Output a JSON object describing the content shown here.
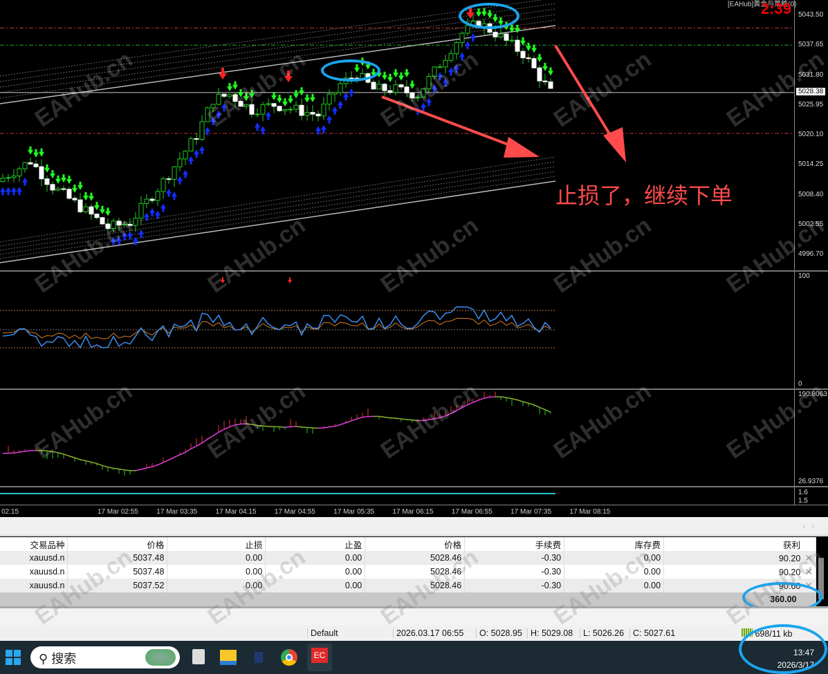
{
  "chart": {
    "title": "[EAHub]黄金与策略(0)",
    "countdown": "2:39",
    "current_price": "5028.38",
    "price_labels": [
      "5043.50",
      "5037.65",
      "5031.80",
      "5025.95",
      "5020.10",
      "5014.25",
      "5008.40",
      "5002.55",
      "4996.70"
    ],
    "rsi_labels": [
      "100",
      "0"
    ],
    "osc_labels": [
      "190.8063",
      "26.9376"
    ],
    "vol_labels": [
      "1.6",
      "1.5"
    ],
    "time_labels": [
      "02:15",
      "17 Mar 02:55",
      "17 Mar 03:35",
      "17 Mar 04:15",
      "17 Mar 04:55",
      "17 Mar 05:35",
      "17 Mar 06:15",
      "17 Mar 06:55",
      "17 Mar 07:35",
      "17 Mar 08:15"
    ],
    "annotation": "止损了，继续下单",
    "watermark": "EAHub.cn",
    "colors": {
      "bull_arrow": "#1030ff",
      "bear_arrow": "#20ff20",
      "signal": "#ff2020",
      "highlight": "#1ba4ee",
      "annotation": "#ff4b4b"
    }
  },
  "chart_data": {
    "type": "candlestick",
    "price_path": [
      [
        0,
        5011
      ],
      [
        6,
        5015
      ],
      [
        10,
        5010
      ],
      [
        15,
        5006
      ],
      [
        20,
        5002
      ],
      [
        24,
        5003
      ],
      [
        30,
        5011
      ],
      [
        36,
        5020
      ],
      [
        39,
        5027
      ],
      [
        42,
        5028
      ],
      [
        46,
        5025
      ],
      [
        50,
        5026
      ],
      [
        54,
        5025
      ],
      [
        58,
        5024
      ],
      [
        62,
        5030
      ],
      [
        65,
        5032
      ],
      [
        68,
        5029
      ],
      [
        72,
        5029
      ],
      [
        76,
        5028
      ],
      [
        80,
        5034
      ],
      [
        84,
        5040
      ],
      [
        87,
        5042
      ],
      [
        90,
        5040
      ],
      [
        95,
        5036
      ],
      [
        100,
        5028.4
      ]
    ],
    "ylim": [
      4994,
      5046
    ]
  },
  "positions": {
    "headers": [
      "交易品种",
      "价格",
      "止损",
      "止盈",
      "价格",
      "手续费",
      "库存费",
      "获利"
    ],
    "rows": [
      [
        "xauusd.n",
        "5037.48",
        "0.00",
        "0.00",
        "5028.46",
        "-0.30",
        "0.00",
        "90.20"
      ],
      [
        "xauusd.n",
        "5037.48",
        "0.00",
        "0.00",
        "5028.46",
        "-0.30",
        "0.00",
        "90.20"
      ],
      [
        "xauusd.n",
        "5037.52",
        "0.00",
        "0.00",
        "5028.46",
        "-0.30",
        "0.00",
        "90.60"
      ]
    ],
    "total": "360.00",
    "close_glyph": "✕"
  },
  "status": {
    "profile": "Default",
    "datetime": "2026.03.17 06:55",
    "open": "O: 5028.95",
    "high": "H: 5029.08",
    "low": "L: 5026.26",
    "close": "C: 5027.61",
    "traffic": "698/11 kb"
  },
  "taskbar": {
    "search": "搜索",
    "time": "13:47",
    "date": "2026/3/17",
    "ec": "EC"
  }
}
